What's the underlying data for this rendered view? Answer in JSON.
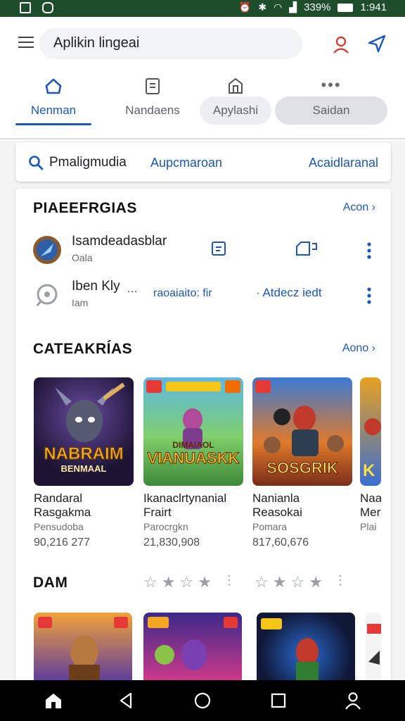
{
  "status_bar": {
    "battery": "339%",
    "time": "1:941"
  },
  "search": {
    "value": "Aplikin lingeai"
  },
  "tabs": [
    {
      "label": "Nenman"
    },
    {
      "label": "Nandaens"
    },
    {
      "label": "Apylashi"
    },
    {
      "label": "Saidan"
    }
  ],
  "search_card": {
    "title": "Pmaligmudia",
    "middle": "Aupcmaroan",
    "right": "Acaidlaranal"
  },
  "recent": {
    "title": "PIAEEFRGIAS",
    "see_all": "Acon",
    "items": [
      {
        "title": "Isamdeadasblar",
        "sub": "Oala"
      },
      {
        "title": "Iben Kly",
        "sub": "Iam",
        "middle": "raoaiaito: fir",
        "right": "· Atdecz iedt"
      }
    ]
  },
  "categories": {
    "title": "CATEAKRÍAS",
    "see_all": "Aono",
    "apps": [
      {
        "name1": "Randaral",
        "name2": "Rasgakma",
        "dev": "Pensudoba",
        "count": "90,216 277",
        "art_title": "NABRAIM",
        "art_sub": "BENMAAL"
      },
      {
        "name1": "Ikanaclrtynanial",
        "name2": "Frairt",
        "dev": "Parocrgkn",
        "count": "21,830,908",
        "art_title": "VIANUASKK",
        "art_sub": "DIMAIAOL"
      },
      {
        "name1": "Nanianla",
        "name2": "Reasokai",
        "dev": "Pomara",
        "count": "817,60,676",
        "art_title": "SOSGRIK",
        "art_sub": ""
      },
      {
        "name1": "Naa",
        "name2": "Mer",
        "dev": "Plai",
        "count": "",
        "art_title": "K",
        "art_sub": ""
      }
    ]
  },
  "dam": {
    "title": "DAM"
  },
  "colors": {
    "accent": "#1a56c4",
    "status_bar": "#1e4d2b"
  }
}
